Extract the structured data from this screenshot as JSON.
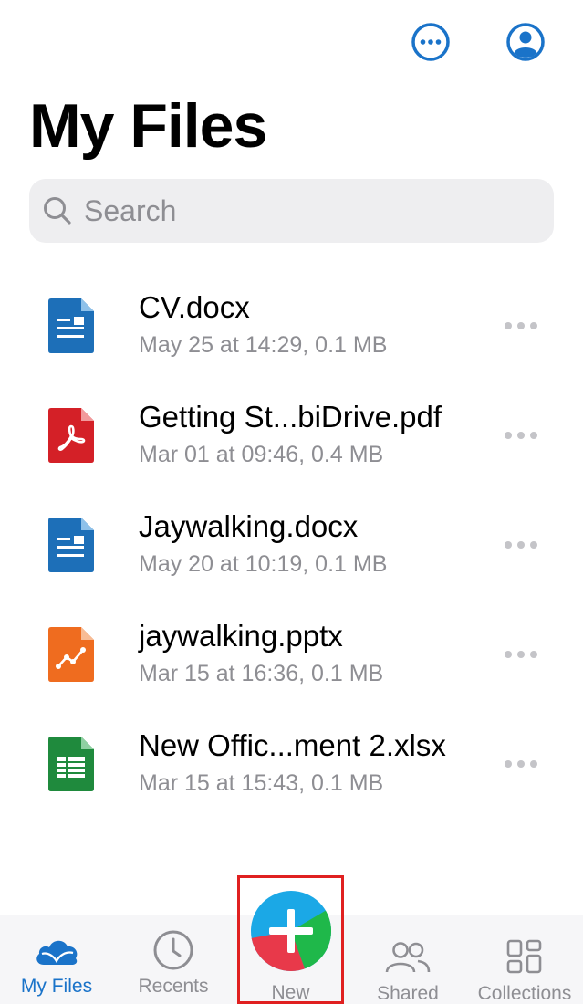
{
  "header": {
    "title": "My Files",
    "more_icon": "ellipsis-circle-icon",
    "account_icon": "person-circle-icon",
    "accent": "#1a73c9"
  },
  "search": {
    "placeholder": "Search",
    "value": ""
  },
  "files": [
    {
      "name": "CV.docx",
      "meta": "May 25 at 14:29, 0.1 MB",
      "type": "docx",
      "icon": "word-document-icon",
      "color": "#1d6fb8"
    },
    {
      "name": "Getting St...biDrive.pdf",
      "meta": "Mar 01 at 09:46, 0.4 MB",
      "type": "pdf",
      "icon": "pdf-document-icon",
      "color": "#d42027"
    },
    {
      "name": "Jaywalking.docx",
      "meta": "May 20 at 10:19, 0.1 MB",
      "type": "docx",
      "icon": "word-document-icon",
      "color": "#1d6fb8"
    },
    {
      "name": "jaywalking.pptx",
      "meta": "Mar 15 at 16:36, 0.1 MB",
      "type": "pptx",
      "icon": "presentation-document-icon",
      "color": "#ef6c1f"
    },
    {
      "name": "New Offic...ment 2.xlsx",
      "meta": "Mar 15 at 15:43, 0.1 MB",
      "type": "xlsx",
      "icon": "spreadsheet-document-icon",
      "color": "#1f8a3d"
    }
  ],
  "tabbar": {
    "tabs": [
      {
        "id": "myfiles",
        "label": "My Files",
        "icon": "cloud-icon",
        "active": true
      },
      {
        "id": "recents",
        "label": "Recents",
        "icon": "clock-icon",
        "active": false
      },
      {
        "id": "new",
        "label": "New",
        "icon": "plus-icon",
        "active": false
      },
      {
        "id": "shared",
        "label": "Shared",
        "icon": "people-icon",
        "active": false
      },
      {
        "id": "collections",
        "label": "Collections",
        "icon": "grid-icon",
        "active": false
      }
    ]
  }
}
